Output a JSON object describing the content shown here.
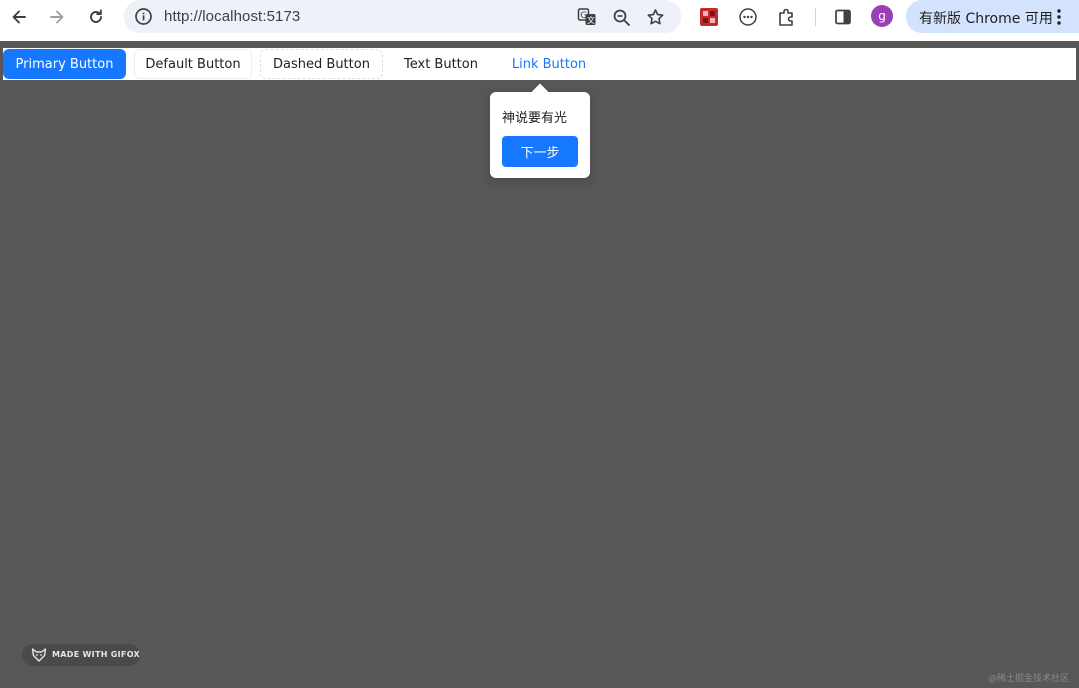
{
  "browser": {
    "url": "http://localhost:5173",
    "avatar_letter": "g",
    "update_label": "有新版 Chrome 可用"
  },
  "icons": {
    "back": "back-arrow-icon",
    "forward": "forward-arrow-icon",
    "reload": "reload-icon",
    "info": "site-info-icon",
    "translate": "translate-icon",
    "zoom": "zoom-icon",
    "bookmark": "bookmark-star-icon",
    "extension_red": "red-extension-icon",
    "extension_circle": "circle-extension-icon",
    "extensions": "puzzle-icon",
    "sidepanel": "side-panel-icon",
    "menu": "kebab-menu-icon"
  },
  "buttons": {
    "primary": "Primary Button",
    "default": "Default Button",
    "dashed": "Dashed Button",
    "text": "Text Button",
    "link": "Link Button"
  },
  "tour": {
    "title": "神说要有光",
    "next_label": "下一步"
  },
  "watermarks": {
    "gifox": "MADE WITH GIFOX",
    "community": "@稀土掘金技术社区"
  },
  "colors": {
    "accent": "#1677ff",
    "mask": "#575757"
  }
}
